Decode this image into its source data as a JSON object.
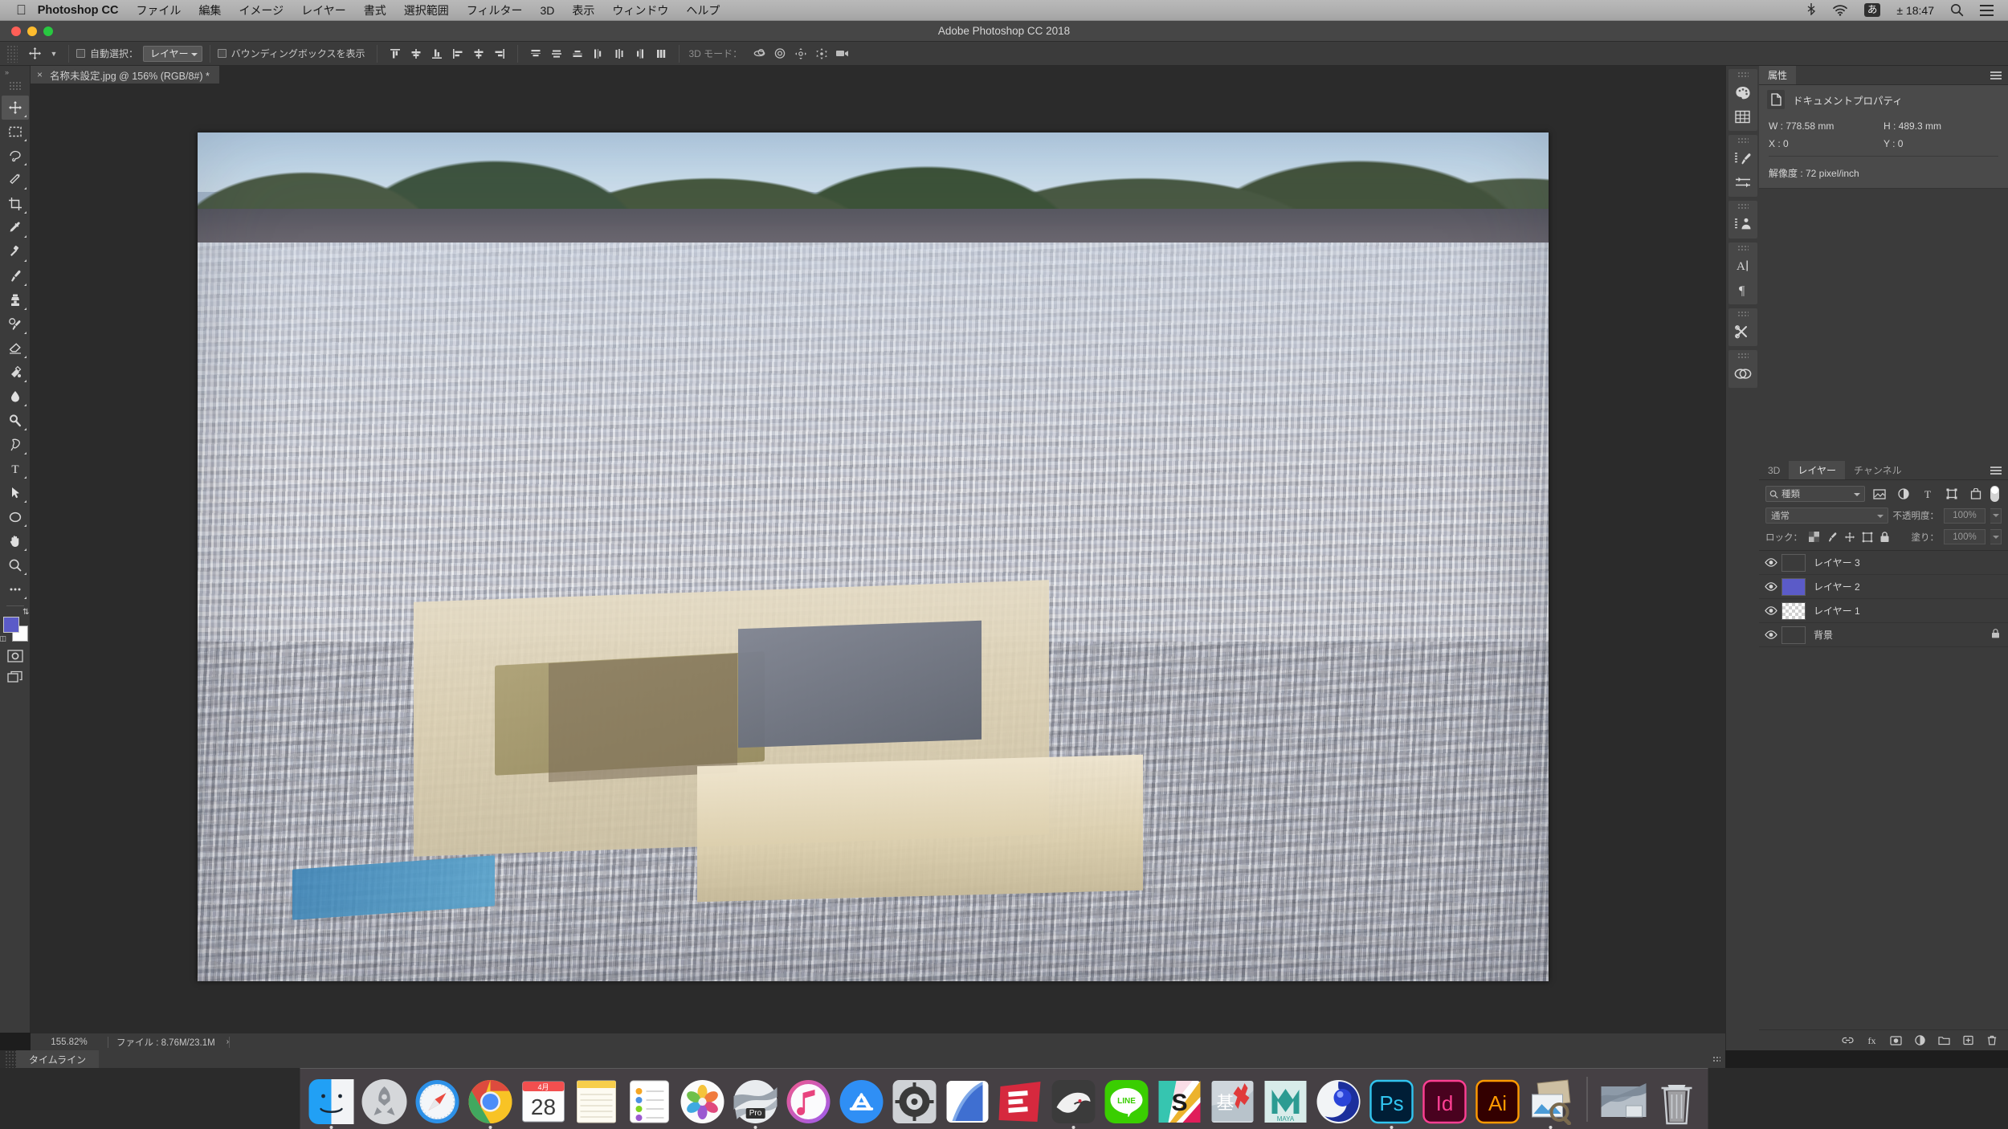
{
  "menubar": {
    "apple_icon": "apple-icon",
    "app_name": "Photoshop CC",
    "items": [
      "ファイル",
      "編集",
      "イメージ",
      "レイヤー",
      "書式",
      "選択範囲",
      "フィルター",
      "3D",
      "表示",
      "ウィンドウ",
      "ヘルプ"
    ],
    "status": {
      "bluetooth_icon": "bluetooth-icon",
      "wifi_icon": "wifi-icon",
      "ime": "あ",
      "clock": "± 18:47",
      "search_icon": "search-icon",
      "control_center_icon": "control-center-icon"
    }
  },
  "window": {
    "title": "Adobe Photoshop CC 2018",
    "traffic_colors": [
      "#ff5f57",
      "#febc2e",
      "#28c840"
    ]
  },
  "options_bar": {
    "tool_icon": "move-tool-icon",
    "auto_select_label": "自動選択：",
    "auto_select_value": "レイヤー",
    "bounding_box_label": "バウンディングボックスを表示",
    "mode3d_label": "3D モード：",
    "align_icons": [
      "align-top-icon",
      "align-vertical-center-icon",
      "align-bottom-icon",
      "align-left-icon",
      "align-horizontal-center-icon",
      "align-right-icon"
    ],
    "distribute_icons": [
      "distribute-top-icon",
      "distribute-vertical-center-icon",
      "distribute-bottom-icon",
      "distribute-left-icon",
      "distribute-horizontal-center-icon",
      "distribute-right-icon",
      "distribute-spacing-icon"
    ],
    "mode3d_icons": [
      "orbit-3d-icon",
      "roll-3d-icon",
      "pan-3d-icon",
      "slide-3d-icon",
      "camera-3d-icon"
    ]
  },
  "document": {
    "tab_title": "名称未設定.jpg @ 156% (RGB/8#) *",
    "close_glyph": "×"
  },
  "toolbar": {
    "collapse_glyph": "»",
    "tools": [
      {
        "name": "move-tool",
        "selected": true
      },
      {
        "name": "rectangular-marquee-tool",
        "selected": false
      },
      {
        "name": "lasso-tool",
        "selected": false
      },
      {
        "name": "magic-wand-tool",
        "selected": false
      },
      {
        "name": "crop-tool",
        "selected": false
      },
      {
        "name": "eyedropper-tool",
        "selected": false
      },
      {
        "name": "healing-brush-tool",
        "selected": false
      },
      {
        "name": "brush-tool",
        "selected": false
      },
      {
        "name": "clone-stamp-tool",
        "selected": false
      },
      {
        "name": "history-brush-tool",
        "selected": false
      },
      {
        "name": "eraser-tool",
        "selected": false
      },
      {
        "name": "gradient-tool",
        "selected": false
      },
      {
        "name": "blur-tool",
        "selected": false
      },
      {
        "name": "dodge-tool",
        "selected": false
      },
      {
        "name": "pen-tool",
        "selected": false
      },
      {
        "name": "type-tool",
        "selected": false
      },
      {
        "name": "path-selection-tool",
        "selected": false
      },
      {
        "name": "ellipse-shape-tool",
        "selected": false
      },
      {
        "name": "hand-tool",
        "selected": false
      },
      {
        "name": "zoom-tool",
        "selected": false
      },
      {
        "name": "edit-toolbar-tool",
        "selected": false
      }
    ],
    "foreground_color": "#5b5bc8",
    "background_color": "#ffffff",
    "quick_mask_icon": "quick-mask-icon",
    "screen_mode_icon": "screen-mode-icon"
  },
  "rail": {
    "groups": [
      [
        "color-palette-icon",
        "swatches-grid-icon"
      ],
      [
        "brush-presets-icon",
        "adjustments-icon"
      ],
      [
        "styles-stamp-icon"
      ],
      [
        "character-panel-icon",
        "paragraph-panel-icon"
      ],
      [
        "tool-presets-icon"
      ],
      [
        "creative-cloud-libraries-icon"
      ]
    ]
  },
  "properties_panel": {
    "tab_label": "属性",
    "menu_icon": "panel-menu-icon",
    "doc_icon": "document-icon",
    "section_title": "ドキュメントプロパティ",
    "width_label": "W : 778.58 mm",
    "height_label": "H : 489.3 mm",
    "x_label": "X : 0",
    "y_label": "Y : 0",
    "resolution_label": "解像度 : 72 pixel/inch"
  },
  "layers_panel": {
    "tabs": [
      {
        "label": "3D",
        "active": false
      },
      {
        "label": "レイヤー",
        "active": true
      },
      {
        "label": "チャンネル",
        "active": false
      }
    ],
    "menu_icon": "panel-menu-icon",
    "filter_label": "種類",
    "filter_icons": [
      "filter-pixel-icon",
      "filter-adjustment-icon",
      "filter-type-icon",
      "filter-shape-icon",
      "filter-smart-object-icon"
    ],
    "filter_toggle_icon": "filter-toggle-switch",
    "blend_mode": "通常",
    "opacity_label": "不透明度：",
    "opacity_value": "100%",
    "lock_label": "ロック：",
    "lock_icons": [
      "lock-transparent-pixels-icon",
      "lock-image-pixels-icon",
      "lock-position-icon",
      "lock-artboard-icon",
      "lock-all-icon"
    ],
    "fill_label": "塗り：",
    "fill_value": "100%",
    "rows": [
      {
        "name": "レイヤー 3",
        "thumb": "texture",
        "visible": true,
        "locked": false
      },
      {
        "name": "レイヤー 2",
        "thumb": "solid",
        "thumb_color": "#5b5bc8",
        "visible": true,
        "locked": false
      },
      {
        "name": "レイヤー 1",
        "thumb": "transparent",
        "visible": true,
        "locked": false
      },
      {
        "name": "背景",
        "thumb": "photo",
        "visible": true,
        "locked": true
      }
    ],
    "bottom_icons": [
      "link-layers-icon",
      "layer-style-icon",
      "layer-mask-icon",
      "adjustment-layer-icon",
      "new-group-icon",
      "new-layer-icon",
      "delete-layer-icon"
    ]
  },
  "status_bar": {
    "zoom": "155.82%",
    "file_info": "ファイル : 8.76M/23.1M",
    "expand_glyph": "›"
  },
  "timeline_panel": {
    "tab_label": "タイムライン"
  },
  "dock": {
    "items": [
      {
        "name": "finder",
        "label": "Finder",
        "running": true
      },
      {
        "name": "launchpad",
        "label": "Launchpad",
        "running": false
      },
      {
        "name": "safari",
        "label": "Safari",
        "running": false
      },
      {
        "name": "google-chrome",
        "label": "Google Chrome",
        "running": true
      },
      {
        "name": "calendar",
        "label": "カレンダー",
        "running": false,
        "month": "4月",
        "day": "28"
      },
      {
        "name": "notes",
        "label": "メモ",
        "running": false
      },
      {
        "name": "reminders",
        "label": "リマインダー",
        "running": false
      },
      {
        "name": "photos",
        "label": "写真",
        "running": false
      },
      {
        "name": "google-earth-pro",
        "label": "Pro",
        "running": true
      },
      {
        "name": "itunes",
        "label": "iTunes",
        "running": false
      },
      {
        "name": "app-store",
        "label": "App Store",
        "running": false
      },
      {
        "name": "system-preferences",
        "label": "システム環境設定",
        "running": false
      },
      {
        "name": "vectorworks",
        "label": "Vectorworks",
        "running": false
      },
      {
        "name": "sketchup",
        "label": "SketchUp",
        "running": false
      },
      {
        "name": "rhinoceros",
        "label": "Rhinoceros",
        "running": true
      },
      {
        "name": "line",
        "label": "LINE",
        "running": false
      },
      {
        "name": "slack",
        "label": "Slack",
        "running": false
      },
      {
        "name": "kiban-chizu",
        "label": "基盤地図",
        "running": false
      },
      {
        "name": "autodesk-maya",
        "label": "MAYA",
        "running": false
      },
      {
        "name": "cinema-4d",
        "label": "Cinema 4D",
        "running": false
      },
      {
        "name": "adobe-photoshop",
        "label": "Ps",
        "running": true
      },
      {
        "name": "adobe-indesign",
        "label": "Id",
        "running": false
      },
      {
        "name": "adobe-illustrator",
        "label": "Ai",
        "running": false
      },
      {
        "name": "preview",
        "label": "プレビュー",
        "running": true
      }
    ],
    "minimized": {
      "name": "minimized-document",
      "label": "名称未設定.jpg"
    },
    "trash": {
      "name": "trash",
      "label": "ゴミ箱"
    }
  }
}
